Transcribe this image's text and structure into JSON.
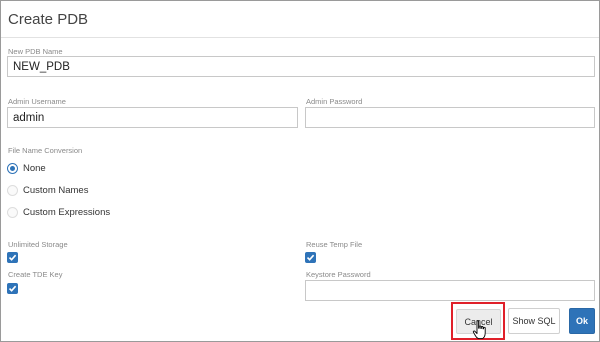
{
  "dialog": {
    "title": "Create PDB"
  },
  "form": {
    "pdb_name": {
      "label": "New PDB Name",
      "value": "NEW_PDB"
    },
    "admin_username": {
      "label": "Admin Username",
      "value": "admin"
    },
    "admin_password": {
      "label": "Admin Password",
      "value": ""
    },
    "file_name_conversion": {
      "label": "File Name Conversion",
      "options": [
        "None",
        "Custom Names",
        "Custom Expressions"
      ],
      "selected": "None"
    },
    "unlimited_storage": {
      "label": "Unlimited Storage",
      "checked": true
    },
    "reuse_temp_file": {
      "label": "Reuse Temp File",
      "checked": true
    },
    "create_tde_key": {
      "label": "Create TDE Key",
      "checked": true
    },
    "keystore_password": {
      "label": "Keystore Password",
      "value": ""
    }
  },
  "buttons": {
    "cancel": "Cancel",
    "show_sql": "Show SQL",
    "ok": "Ok"
  },
  "colors": {
    "accent": "#2e73b8",
    "highlight": "#e0202a"
  },
  "icons": {
    "check": "check-icon",
    "cursor": "hand-pointer-icon"
  }
}
